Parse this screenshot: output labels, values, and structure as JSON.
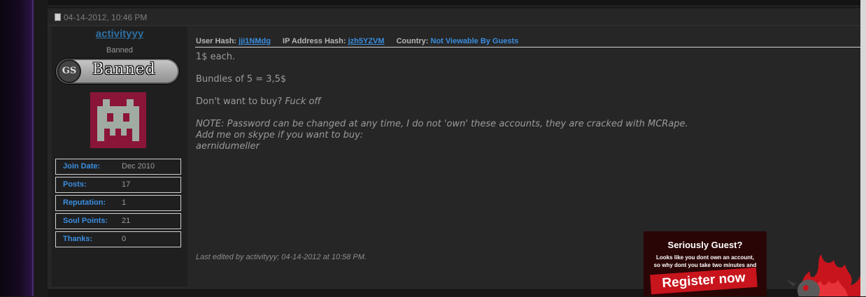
{
  "post": {
    "date": "04-14-2012, 10:46 PM",
    "username": "activityyy",
    "user_title": "Banned",
    "rank_image_text": "Banned",
    "rank_logo_text": "GS",
    "stats": [
      {
        "label": "Join Date:",
        "value": "Dec 2010"
      },
      {
        "label": "Posts:",
        "value": "17"
      },
      {
        "label": "Reputation:",
        "value": "1"
      },
      {
        "label": "Soul Points:",
        "value": "21"
      },
      {
        "label": "Thanks:",
        "value": "0"
      }
    ],
    "meta": {
      "user_hash_label": "User Hash:",
      "user_hash": "jji1NMdg",
      "ip_hash_label": "IP Address Hash:",
      "ip_hash": "jzh5YZVM",
      "country_label": "Country:",
      "country": "Not Viewable By Guests"
    },
    "message": {
      "line1": "1$ each.",
      "line2": "Bundles of 5 = 3,5$",
      "line3_prefix": "Don't want to buy?",
      "line3_italic": "Fuck off",
      "note1": "NOTE: Password can be changed at any time, I do not 'own' these accounts, they are cracked with MCRape.",
      "note2": "Add me on skype if you want to buy:",
      "note3": "aernidumeller"
    },
    "edited": "Last edited by activityyy; 04-14-2012 at 10:58 PM."
  },
  "guest_banner": {
    "title": "Seriously Guest?",
    "line1": "Looks like you dont own an account,",
    "line2": "so why dont you take two minutes and",
    "button": "Register now"
  },
  "colors": {
    "link": "#3a8ee0",
    "username": "#2f6fa0",
    "text": "#9b9b9b",
    "background": "#262626",
    "banner_red": "#c8141c"
  },
  "icons": [
    "document-icon",
    "gs-logo-icon",
    "space-invader-avatar",
    "flame-mascot-icon"
  ]
}
